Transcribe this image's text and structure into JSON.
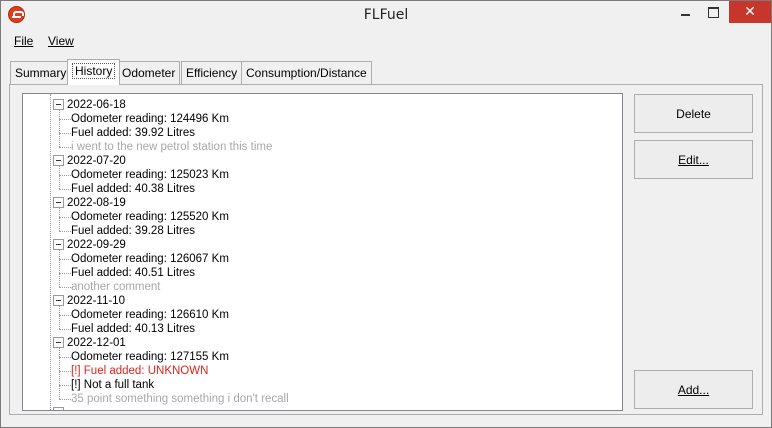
{
  "window": {
    "title": "FLFuel"
  },
  "menu": {
    "file": "File",
    "view": "View"
  },
  "tabs": [
    {
      "label": "Summary"
    },
    {
      "label": "History",
      "active": true
    },
    {
      "label": "Odometer"
    },
    {
      "label": "Efficiency"
    },
    {
      "label": "Consumption/Distance"
    }
  ],
  "history": {
    "entries": [
      {
        "date": "2022-06-18",
        "children": [
          {
            "text": "Odometer reading: 124496 Km",
            "style": "normal"
          },
          {
            "text": "Fuel added: 39.92 Litres",
            "style": "normal"
          },
          {
            "text": "i went to the new petrol station this time",
            "style": "comment"
          }
        ]
      },
      {
        "date": "2022-07-20",
        "children": [
          {
            "text": "Odometer reading: 125023 Km",
            "style": "normal"
          },
          {
            "text": "Fuel added: 40.38 Litres",
            "style": "normal"
          }
        ]
      },
      {
        "date": "2022-08-19",
        "children": [
          {
            "text": "Odometer reading: 125520 Km",
            "style": "normal"
          },
          {
            "text": "Fuel added: 39.28 Litres",
            "style": "normal"
          }
        ]
      },
      {
        "date": "2022-09-29",
        "children": [
          {
            "text": "Odometer reading: 126067 Km",
            "style": "normal"
          },
          {
            "text": "Fuel added: 40.51 Litres",
            "style": "normal"
          },
          {
            "text": "another comment",
            "style": "comment"
          }
        ]
      },
      {
        "date": "2022-11-10",
        "children": [
          {
            "text": "Odometer reading: 126610 Km",
            "style": "normal"
          },
          {
            "text": "Fuel added: 40.13 Litres",
            "style": "normal"
          }
        ]
      },
      {
        "date": "2022-12-01",
        "children": [
          {
            "text": "Odometer reading: 127155 Km",
            "style": "normal"
          },
          {
            "text": "[!] Fuel added: UNKNOWN",
            "style": "warning"
          },
          {
            "text": "[!] Not a full tank",
            "style": "normal"
          },
          {
            "text": "35 point something something i don't recall",
            "style": "comment"
          }
        ]
      }
    ]
  },
  "buttons": {
    "delete": "Delete",
    "edit": "Edit...",
    "add": "Add..."
  },
  "colors": {
    "close_button": "#c7362b",
    "warning_text": "#e0231b",
    "comment_text": "#a8a8a8"
  }
}
